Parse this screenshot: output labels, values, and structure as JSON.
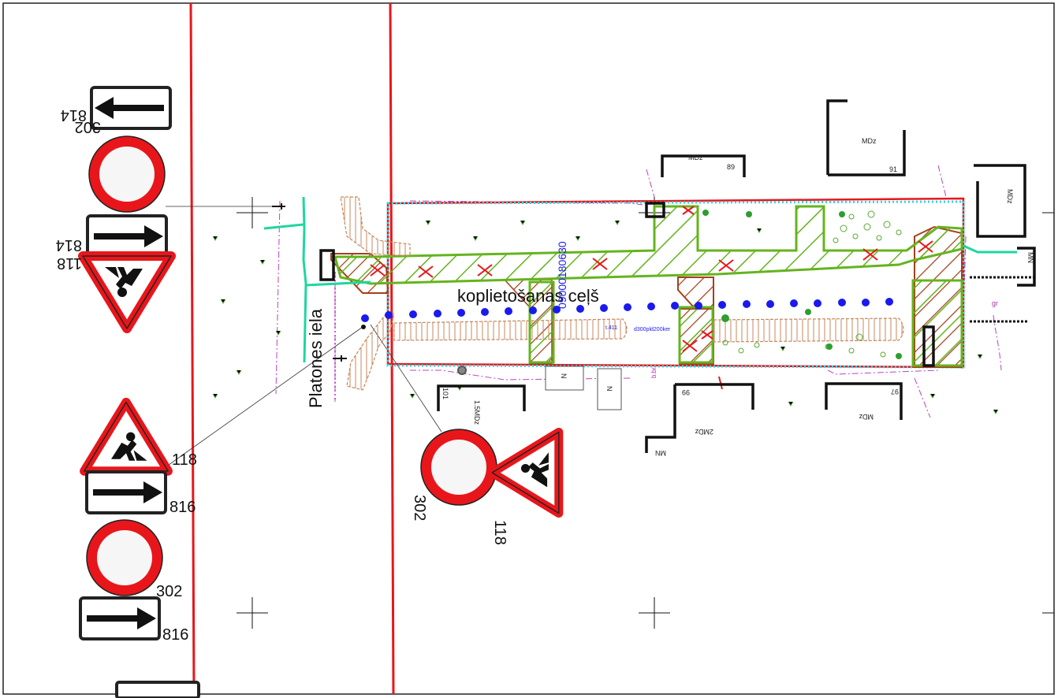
{
  "street_label": "Platones iela",
  "road_label": "koplietošanas ceļš",
  "cadastre_label": "09000180630",
  "signs": {
    "code_302": "302",
    "code_118": "118",
    "code_814": "814",
    "code_816": "816"
  },
  "buildings": [
    {
      "type": "MDz",
      "number": "89"
    },
    {
      "type": "MDz",
      "number": "91"
    },
    {
      "type": "MDz",
      "number": ""
    },
    {
      "type": "MN",
      "number": ""
    },
    {
      "type": "1.5MDz",
      "number": "101"
    },
    {
      "type": "2MDz",
      "number": "99"
    },
    {
      "type": "MDz",
      "number": "97"
    },
    {
      "type": "MN",
      "number": ""
    },
    {
      "type": "N",
      "number": ""
    },
    {
      "type": "N",
      "number": ""
    }
  ],
  "utility_labels": {
    "pipe_1": "d300pld200ker",
    "pipe_2": "t.411",
    "mark_b_br": "b.br.",
    "mark_gr": "gr"
  },
  "colors": {
    "boundary_red": "#e8161b",
    "hatch_green": "#64b41e",
    "hatch_brown": "#a5401c",
    "survey_cyan": "#33d6e6",
    "point_blue": "#1a1aee",
    "utility_teal": "#1fd6a0",
    "contour_magenta": "#c040c0"
  }
}
